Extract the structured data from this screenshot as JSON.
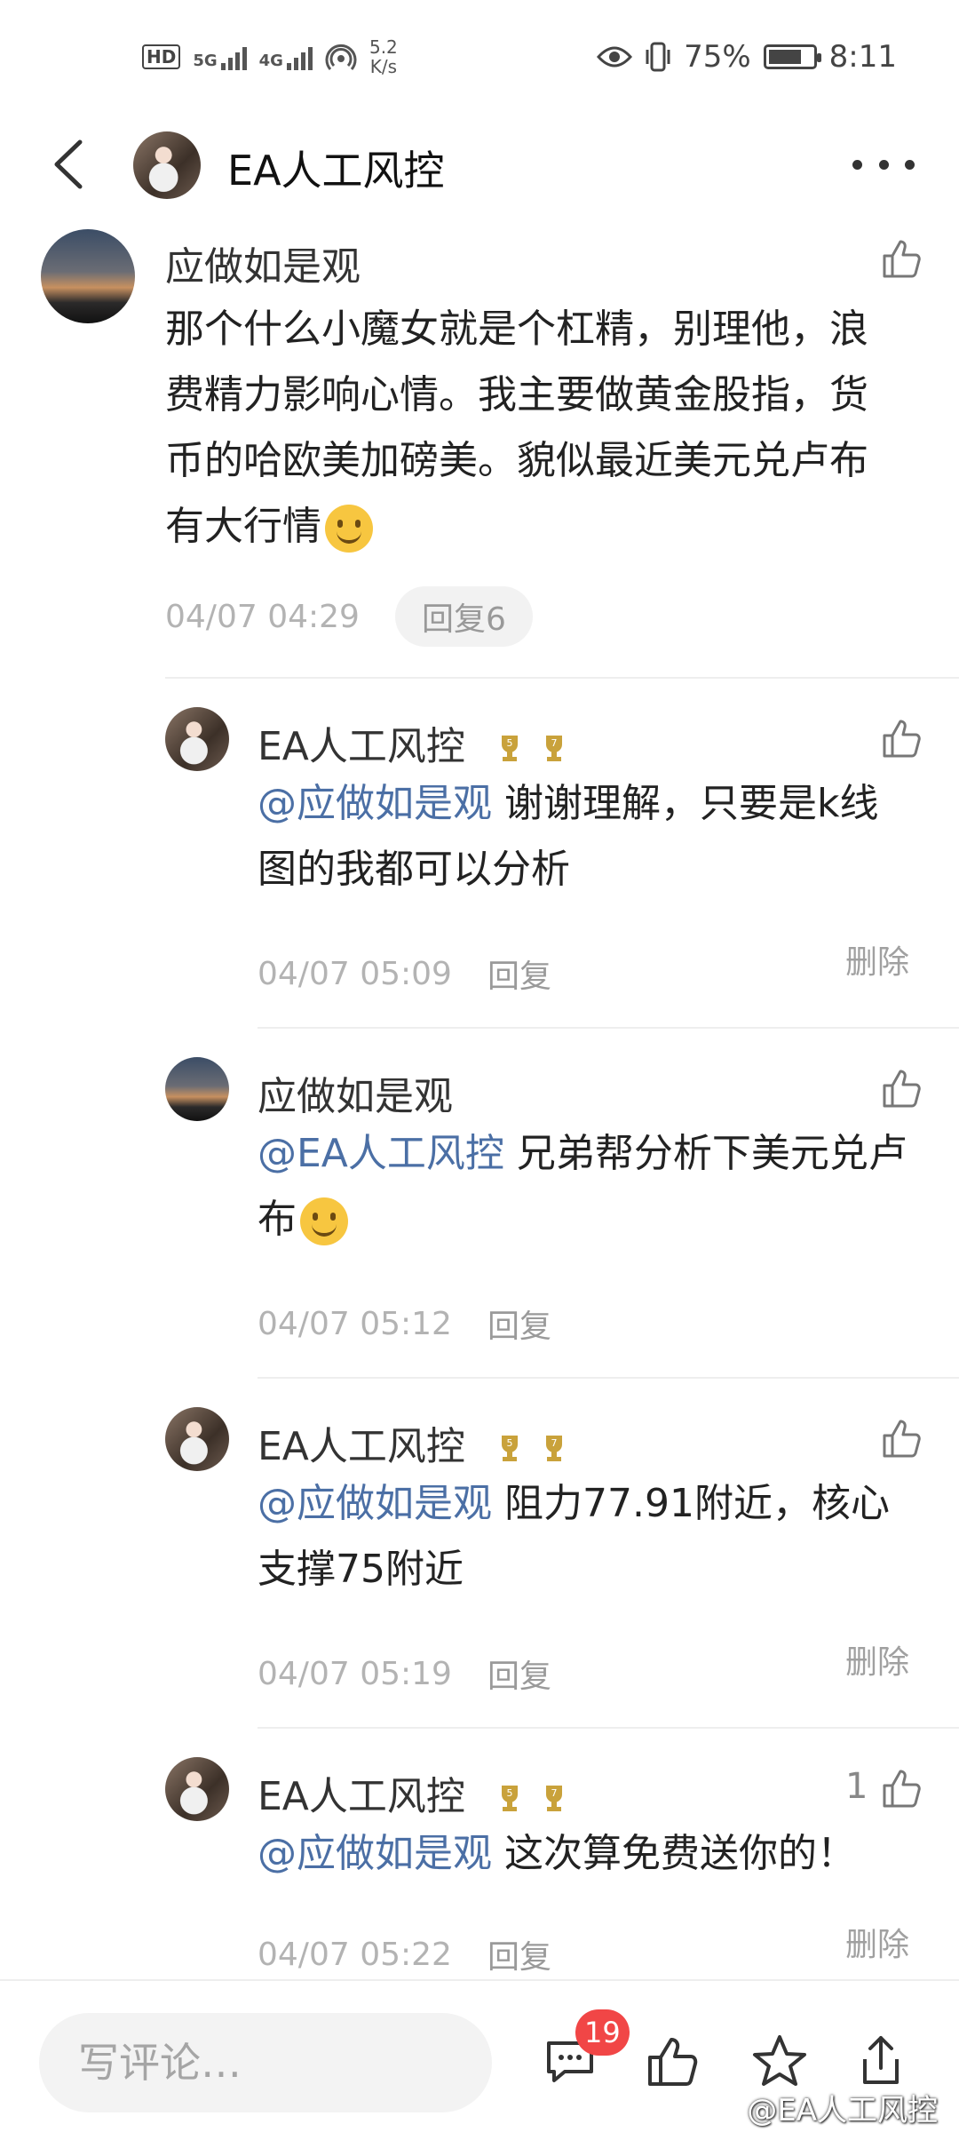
{
  "status_bar": {
    "hd": "HD",
    "net1": "5G",
    "net2": "4G",
    "speed_value": "5.2",
    "speed_unit": "K/s",
    "battery": "75%",
    "battery_level": 0.75,
    "time": "8:11"
  },
  "header": {
    "title": "EA人工风控"
  },
  "comments": [
    {
      "name": "应做如是观",
      "text": "那个什么小魔女就是个杠精，别理他，浪费精力影响心情。我主要做黄金股指，货币的哈欧美加磅美。貌似最近美元兑卢布有大行情",
      "time": "04/07 04:29",
      "reply": "回复6"
    },
    {
      "name": "EA人工风控",
      "mention": "@应做如是观",
      "text": " 谢谢理解，只要是k线图的我都可以分析",
      "time": "04/07 05:09",
      "reply": "回复",
      "delete": "删除",
      "badge1": "5",
      "badge2": "7"
    },
    {
      "name": "应做如是观",
      "mention": "@EA人工风控",
      "text": " 兄弟帮分析下美元兑卢布",
      "time": "04/07 05:12",
      "reply": "回复"
    },
    {
      "name": "EA人工风控",
      "mention": "@应做如是观",
      "text": " 阻力77.91附近，核心支撑75附近",
      "time": "04/07 05:19",
      "reply": "回复",
      "delete": "删除",
      "badge1": "5",
      "badge2": "7"
    },
    {
      "name": "EA人工风控",
      "mention": "@应做如是观",
      "text": " 这次算免费送你的！",
      "time": "04/07 05:22",
      "reply": "回复",
      "delete": "删除",
      "likes": "1",
      "badge1": "5",
      "badge2": "7"
    }
  ],
  "bottom_bar": {
    "placeholder": "写评论…",
    "comment_count": "19",
    "watermark": "@EA人工风控"
  },
  "colors": {
    "mention": "#4b6fa5",
    "badge_red": "#f14646"
  }
}
